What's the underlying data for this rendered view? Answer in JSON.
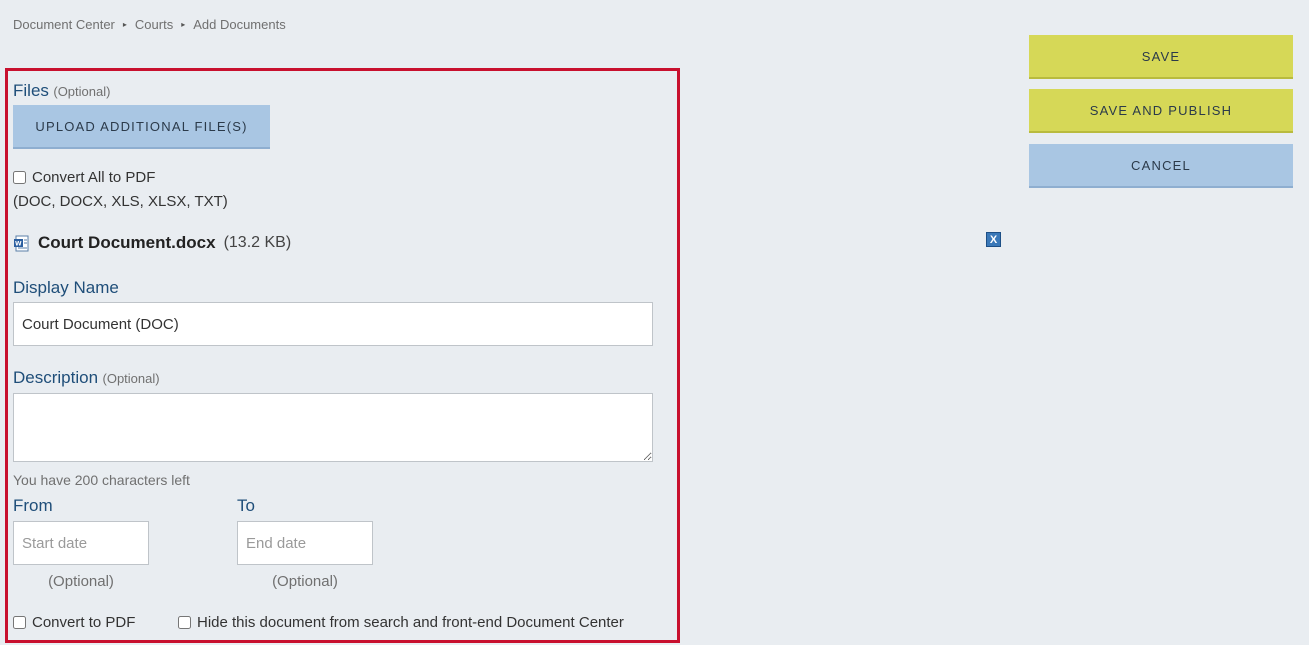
{
  "breadcrumb": {
    "items": [
      "Document Center",
      "Courts",
      "Add Documents"
    ],
    "separator": "▸"
  },
  "files": {
    "label": "Files",
    "optional": "(Optional)",
    "upload_label": "UPLOAD ADDITIONAL FILE(S)",
    "convert_all_label": "Convert All to PDF",
    "formats": "(DOC, DOCX, XLS, XLSX, TXT)"
  },
  "file": {
    "name": "Court Document.docx",
    "size": "(13.2 KB)",
    "remove_icon": "X"
  },
  "display_name": {
    "label": "Display Name",
    "value": "Court Document (DOC)"
  },
  "description": {
    "label": "Description",
    "optional": "(Optional)",
    "value": "",
    "chars_left": "You have 200 characters left"
  },
  "dates": {
    "from_label": "From",
    "to_label": "To",
    "start_placeholder": "Start date",
    "end_placeholder": "End date",
    "from_optional": "(Optional)",
    "to_optional": "(Optional)"
  },
  "options": {
    "convert_pdf_label": "Convert to PDF",
    "hide_label": "Hide this document from search and front-end Document Center"
  },
  "actions": {
    "save_label": "SAVE",
    "save_publish_label": "SAVE AND PUBLISH",
    "cancel_label": "CANCEL"
  },
  "colors": {
    "highlight_border": "#c8102e",
    "primary_button": "#d6d857",
    "secondary_button": "#a9c6e3",
    "label_blue": "#1f4e79"
  }
}
